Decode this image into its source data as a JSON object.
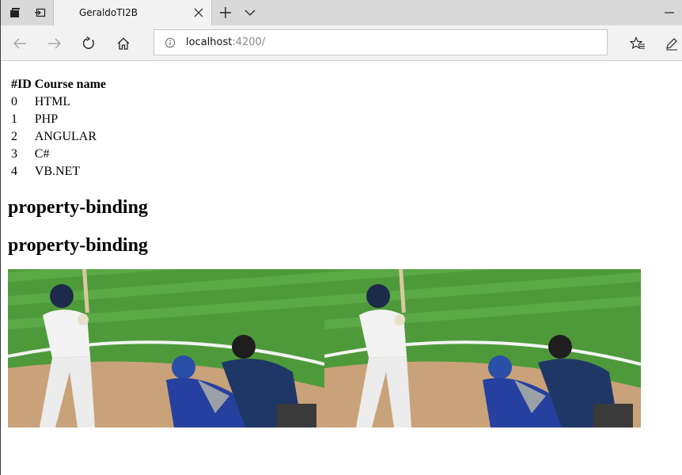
{
  "browser": {
    "tab": {
      "title": "GeraldoTI2B"
    },
    "address": {
      "host": "localhost",
      "port": ":4200/"
    }
  },
  "page": {
    "table": {
      "headers": [
        "#ID",
        "Course name"
      ],
      "rows": [
        [
          "0",
          "HTML"
        ],
        [
          "1",
          "PHP"
        ],
        [
          "2",
          "ANGULAR"
        ],
        [
          "3",
          "C#"
        ],
        [
          "4",
          "VB.NET"
        ]
      ]
    },
    "headings": [
      "property-binding",
      "property-binding"
    ],
    "images": [
      {
        "icon": "baseball-photo"
      },
      {
        "icon": "baseball-photo"
      }
    ]
  },
  "colors": {
    "tabstrip": "#d9d9d9",
    "toolbar": "#f2f2f2",
    "field_grass": "#4e9a3a",
    "dirt": "#c9a27a"
  }
}
